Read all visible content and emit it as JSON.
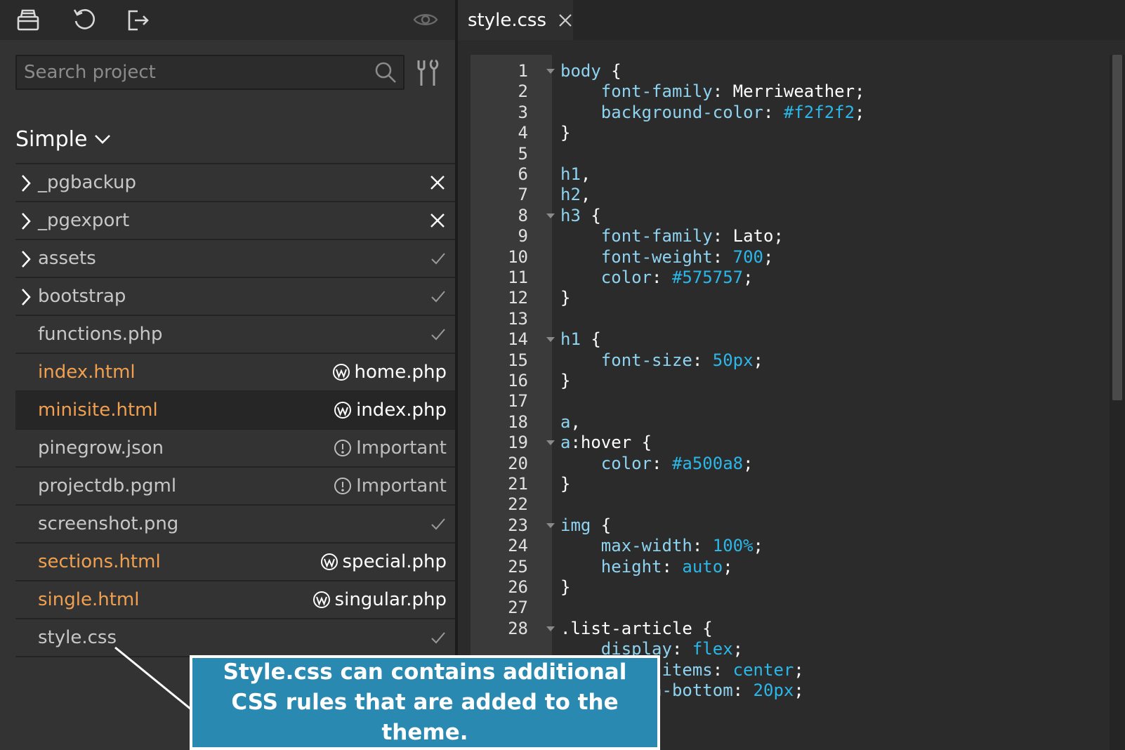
{
  "toolbar": {
    "tools": [
      {
        "icon": "save-icon"
      },
      {
        "icon": "undo-icon"
      },
      {
        "icon": "export-icon"
      },
      {
        "icon": "eye-icon"
      }
    ]
  },
  "search": {
    "placeholder": "Search project",
    "value": ""
  },
  "project": {
    "title": "Simple"
  },
  "files": [
    {
      "name": "_pgbackup",
      "folder": true,
      "color": "normal",
      "status": "close"
    },
    {
      "name": "_pgexport",
      "folder": true,
      "color": "normal",
      "status": "close"
    },
    {
      "name": "assets",
      "folder": true,
      "color": "normal",
      "status": "check"
    },
    {
      "name": "bootstrap",
      "folder": true,
      "color": "normal",
      "status": "check"
    },
    {
      "name": "functions.php",
      "folder": false,
      "color": "normal",
      "status": "check"
    },
    {
      "name": "index.html",
      "folder": false,
      "color": "orange",
      "status": "wp",
      "status_label": "home.php"
    },
    {
      "name": "minisite.html",
      "folder": false,
      "color": "orange",
      "status": "wp",
      "status_label": "index.php",
      "selected": true
    },
    {
      "name": "pinegrow.json",
      "folder": false,
      "color": "normal",
      "status": "important",
      "status_label": "Important"
    },
    {
      "name": "projectdb.pgml",
      "folder": false,
      "color": "normal",
      "status": "important",
      "status_label": "Important"
    },
    {
      "name": "screenshot.png",
      "folder": false,
      "color": "normal",
      "status": "check"
    },
    {
      "name": "sections.html",
      "folder": false,
      "color": "orange",
      "status": "wp",
      "status_label": "special.php"
    },
    {
      "name": "single.html",
      "folder": false,
      "color": "orange",
      "status": "wp",
      "status_label": "singular.php"
    },
    {
      "name": "style.css",
      "folder": false,
      "color": "normal",
      "status": "check"
    }
  ],
  "editor": {
    "tab": {
      "label": "style.css"
    },
    "lines": [
      {
        "n": "1",
        "fold": true,
        "tokens": [
          [
            "sel",
            "body"
          ],
          [
            "punc",
            " {"
          ]
        ]
      },
      {
        "n": "2",
        "tokens": [
          [
            "punc",
            "    "
          ],
          [
            "prop",
            "font-family"
          ],
          [
            "punc",
            ": "
          ],
          [
            "val",
            "Merriweather"
          ],
          [
            "punc",
            ";"
          ]
        ]
      },
      {
        "n": "3",
        "tokens": [
          [
            "punc",
            "    "
          ],
          [
            "prop",
            "background-color"
          ],
          [
            "punc",
            ": "
          ],
          [
            "num",
            "#f2f2f2"
          ],
          [
            "punc",
            ";"
          ]
        ]
      },
      {
        "n": "4",
        "tokens": [
          [
            "punc",
            "}"
          ]
        ]
      },
      {
        "n": "5",
        "tokens": []
      },
      {
        "n": "6",
        "tokens": [
          [
            "sel",
            "h1"
          ],
          [
            "punc",
            ","
          ]
        ]
      },
      {
        "n": "7",
        "tokens": [
          [
            "sel",
            "h2"
          ],
          [
            "punc",
            ","
          ]
        ]
      },
      {
        "n": "8",
        "fold": true,
        "tokens": [
          [
            "sel",
            "h3"
          ],
          [
            "punc",
            " {"
          ]
        ]
      },
      {
        "n": "9",
        "tokens": [
          [
            "punc",
            "    "
          ],
          [
            "prop",
            "font-family"
          ],
          [
            "punc",
            ": "
          ],
          [
            "val",
            "Lato"
          ],
          [
            "punc",
            ";"
          ]
        ]
      },
      {
        "n": "10",
        "tokens": [
          [
            "punc",
            "    "
          ],
          [
            "prop",
            "font-weight"
          ],
          [
            "punc",
            ": "
          ],
          [
            "num",
            "700"
          ],
          [
            "punc",
            ";"
          ]
        ]
      },
      {
        "n": "11",
        "tokens": [
          [
            "punc",
            "    "
          ],
          [
            "prop",
            "color"
          ],
          [
            "punc",
            ": "
          ],
          [
            "num",
            "#575757"
          ],
          [
            "punc",
            ";"
          ]
        ]
      },
      {
        "n": "12",
        "tokens": [
          [
            "punc",
            "}"
          ]
        ]
      },
      {
        "n": "13",
        "tokens": []
      },
      {
        "n": "14",
        "fold": true,
        "tokens": [
          [
            "sel",
            "h1"
          ],
          [
            "punc",
            " {"
          ]
        ]
      },
      {
        "n": "15",
        "tokens": [
          [
            "punc",
            "    "
          ],
          [
            "prop",
            "font-size"
          ],
          [
            "punc",
            ": "
          ],
          [
            "num",
            "50px"
          ],
          [
            "punc",
            ";"
          ]
        ]
      },
      {
        "n": "16",
        "tokens": [
          [
            "punc",
            "}"
          ]
        ]
      },
      {
        "n": "17",
        "tokens": []
      },
      {
        "n": "18",
        "tokens": [
          [
            "sel",
            "a"
          ],
          [
            "punc",
            ","
          ]
        ]
      },
      {
        "n": "19",
        "fold": true,
        "tokens": [
          [
            "sel",
            "a"
          ],
          [
            "val",
            ":hover"
          ],
          [
            "punc",
            " {"
          ]
        ]
      },
      {
        "n": "20",
        "tokens": [
          [
            "punc",
            "    "
          ],
          [
            "prop",
            "color"
          ],
          [
            "punc",
            ": "
          ],
          [
            "num",
            "#a500a8"
          ],
          [
            "punc",
            ";"
          ]
        ]
      },
      {
        "n": "21",
        "tokens": [
          [
            "punc",
            "}"
          ]
        ]
      },
      {
        "n": "22",
        "tokens": []
      },
      {
        "n": "23",
        "fold": true,
        "tokens": [
          [
            "sel",
            "img"
          ],
          [
            "punc",
            " {"
          ]
        ]
      },
      {
        "n": "24",
        "tokens": [
          [
            "punc",
            "    "
          ],
          [
            "prop",
            "max-width"
          ],
          [
            "punc",
            ": "
          ],
          [
            "num",
            "100%"
          ],
          [
            "punc",
            ";"
          ]
        ]
      },
      {
        "n": "25",
        "tokens": [
          [
            "punc",
            "    "
          ],
          [
            "prop",
            "height"
          ],
          [
            "punc",
            ": "
          ],
          [
            "num",
            "auto"
          ],
          [
            "punc",
            ";"
          ]
        ]
      },
      {
        "n": "26",
        "tokens": [
          [
            "punc",
            "}"
          ]
        ]
      },
      {
        "n": "27",
        "tokens": []
      },
      {
        "n": "28",
        "fold": true,
        "tokens": [
          [
            "val",
            ".list-article"
          ],
          [
            "punc",
            " {"
          ]
        ]
      },
      {
        "n": "",
        "tokens": [
          [
            "punc",
            "    "
          ],
          [
            "prop",
            "display"
          ],
          [
            "punc",
            ": "
          ],
          [
            "num",
            "flex"
          ],
          [
            "punc",
            ";"
          ]
        ]
      },
      {
        "n": "",
        "tokens": [
          [
            "punc",
            "    "
          ],
          [
            "prop",
            "align-items"
          ],
          [
            "punc",
            ": "
          ],
          [
            "num",
            "center"
          ],
          [
            "punc",
            ";"
          ]
        ]
      },
      {
        "n": "",
        "tokens": [
          [
            "punc",
            "    "
          ],
          [
            "prop",
            "margin-bottom"
          ],
          [
            "punc",
            ": "
          ],
          [
            "num",
            "20px"
          ],
          [
            "punc",
            ";"
          ]
        ]
      }
    ]
  },
  "callout": {
    "text": "Style.css can contains additional CSS rules that are added to the theme."
  },
  "colors": {
    "accent_orange": "#f0a050",
    "callout_bg": "#2a89b0",
    "code_number": "#2bb7e8",
    "code_property": "#8ed3f0"
  }
}
